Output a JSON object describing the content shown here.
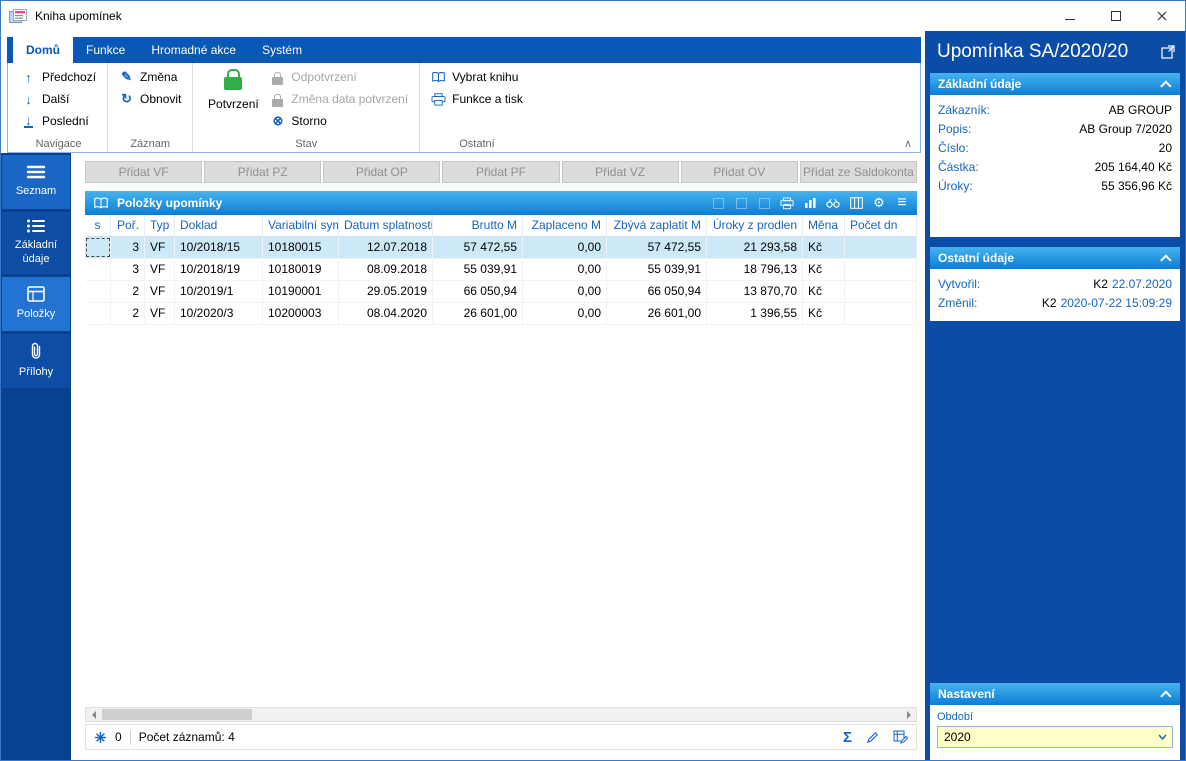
{
  "window": {
    "title": "Kniha upomínek"
  },
  "colors": {
    "accent_blue": "#0a58b6",
    "dark_panel": "#0b4da6",
    "section_header_top": "#45b3ef",
    "section_header_bottom": "#0d7dd4",
    "selection": "#cde9f8",
    "field_yellow": "#ffffc8",
    "confirm_green": "#2fae4a"
  },
  "icons": {
    "arrow_up": "↑",
    "arrow_down": "↓",
    "pencil": "✎",
    "refresh": "↻",
    "cancel": "⊗",
    "gear": "⚙",
    "menu": "≡",
    "chevron_up": "∧",
    "sum": "Σ"
  },
  "ribbon": {
    "tabs": [
      "Domů",
      "Funkce",
      "Hromadné akce",
      "Systém"
    ],
    "active_tab": "Domů",
    "navigace": {
      "label": "Navigace",
      "prev": "Předchozí",
      "next": "Další",
      "last": "Poslední"
    },
    "zaznam": {
      "label": "Záznam",
      "change": "Změna",
      "refresh": "Obnovit"
    },
    "stav": {
      "label": "Stav",
      "confirm": "Potvrzení",
      "unconfirm": "Odpotvrzení",
      "change_date": "Změna data potvrzení",
      "cancel": "Storno"
    },
    "ostatni": {
      "label": "Ostatní",
      "select_book": "Vybrat knihu",
      "functions_print": "Funkce a tisk"
    }
  },
  "sidebar": {
    "items": [
      "Seznam",
      "Základní údaje",
      "Položky",
      "Přílohy"
    ]
  },
  "main": {
    "add_buttons": [
      "Přidat VF",
      "Přidat PZ",
      "Přidat OP",
      "Přidat PF",
      "Přidat VZ",
      "Přidat OV",
      "Přidat ze Saldokonta"
    ],
    "grid_title": "Položky upomínky",
    "columns": [
      "s",
      "Poř.",
      "Typ",
      "Doklad",
      "Variabilní sym",
      "Datum splatnosti",
      "Brutto M",
      "Zaplaceno M",
      "Zbývá zaplatit M",
      "Úroky z prodlen",
      "Měna",
      "Počet dn"
    ],
    "rows": [
      [
        "",
        "3",
        "VF",
        "10/2018/15",
        "10180015",
        "12.07.2018",
        "57 472,55",
        "0,00",
        "57 472,55",
        "21 293,58",
        "Kč",
        ""
      ],
      [
        "",
        "3",
        "VF",
        "10/2018/19",
        "10180019",
        "08.09.2018",
        "55 039,91",
        "0,00",
        "55 039,91",
        "18 796,13",
        "Kč",
        ""
      ],
      [
        "",
        "2",
        "VF",
        "10/2019/1",
        "10190001",
        "29.05.2019",
        "66 050,94",
        "0,00",
        "66 050,94",
        "13 870,70",
        "Kč",
        ""
      ],
      [
        "",
        "2",
        "VF",
        "10/2020/3",
        "10200003",
        "08.04.2020",
        "26 601,00",
        "0,00",
        "26 601,00",
        "1 396,55",
        "Kč",
        ""
      ]
    ],
    "status": {
      "flag_count": "0",
      "records_label": "Počet záznamů: 4"
    }
  },
  "detail": {
    "title": "Upomínka SA/2020/20",
    "zakladni": {
      "title": "Základní údaje",
      "rows": [
        {
          "label": "Zákazník:",
          "value": "AB GROUP"
        },
        {
          "label": "Popis:",
          "value": "AB Group 7/2020"
        },
        {
          "label": "Číslo:",
          "value": "20"
        },
        {
          "label": "Částka:",
          "value": "205 164,40 Kč"
        },
        {
          "label": "Úroky:",
          "value": "55 356,96 Kč"
        }
      ]
    },
    "ostatni": {
      "title": "Ostatní údaje",
      "rows": [
        {
          "label": "Vytvořil:",
          "user": "K2",
          "date": "22.07.2020"
        },
        {
          "label": "Změnil:",
          "user": "K2",
          "date": "2020-07-22 15:09:29"
        }
      ]
    },
    "nastaveni": {
      "title": "Nastavení",
      "field_label": "Období",
      "field_value": "2020"
    }
  }
}
